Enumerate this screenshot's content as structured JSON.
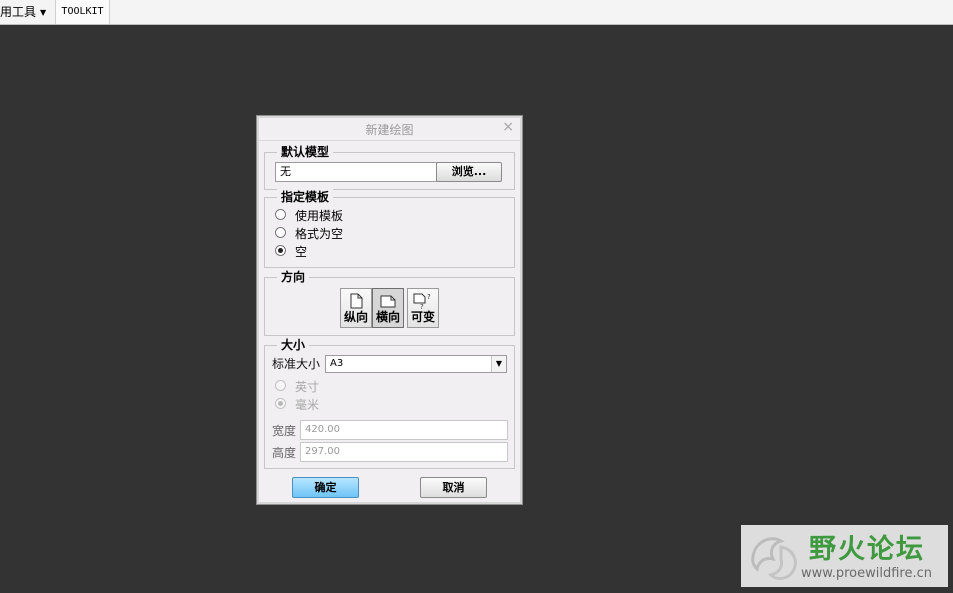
{
  "topbar": {
    "menu_tools": "用工具",
    "tab_toolkit": "TOOLKIT"
  },
  "dialog": {
    "title": "新建绘图",
    "close": "×",
    "default_model": {
      "legend": "默认模型",
      "value": "无",
      "browse_label": "浏览..."
    },
    "template": {
      "legend": "指定模板",
      "options": [
        "使用模板",
        "格式为空",
        "空"
      ],
      "selected": "空"
    },
    "orientation": {
      "legend": "方向",
      "buttons": [
        "纵向",
        "横向",
        "可变"
      ],
      "selected": "横向"
    },
    "size": {
      "legend": "大小",
      "standard_label": "标准大小",
      "standard_value": "A3",
      "unit_options": [
        "英寸",
        "毫米"
      ],
      "unit_selected": "毫米",
      "width_label": "宽度",
      "width_value": "420.00",
      "height_label": "高度",
      "height_value": "297.00"
    },
    "ok_label": "确定",
    "cancel_label": "取消"
  },
  "watermark": {
    "title": "野火论坛",
    "url": "www.proewildfire.cn"
  }
}
